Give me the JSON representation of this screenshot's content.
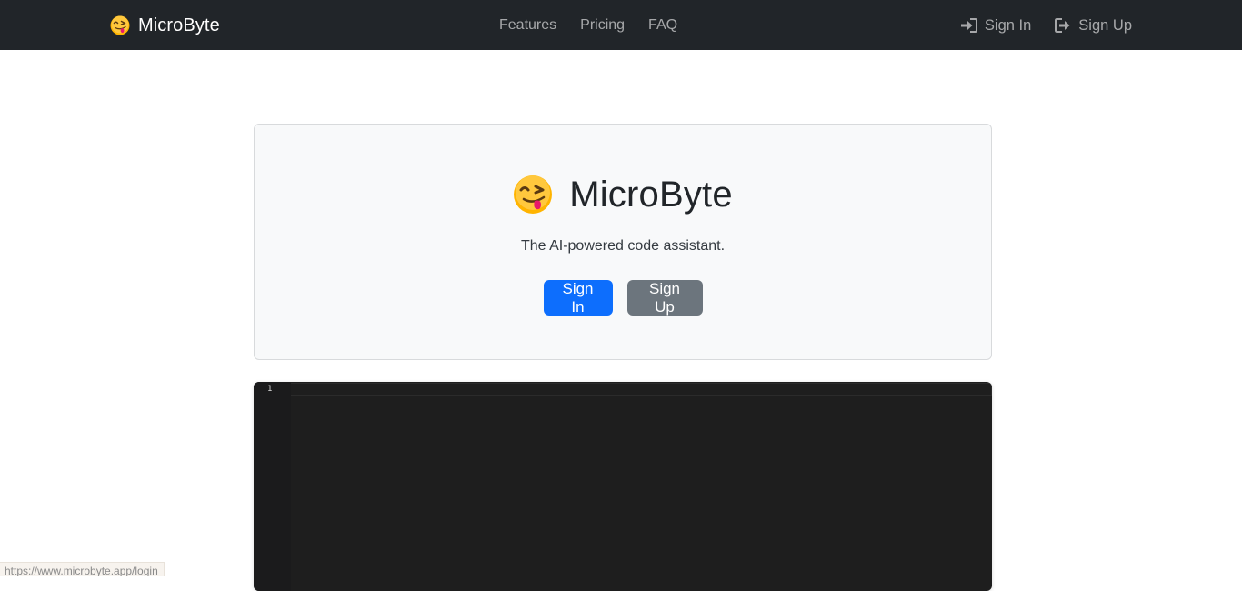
{
  "navbar": {
    "brand": {
      "icon": "face-savoring-food-emoji",
      "label": "MicroByte"
    },
    "links": [
      "Features",
      "Pricing",
      "FAQ"
    ],
    "sign_in": {
      "icon": "sign-in-icon",
      "label": "Sign In"
    },
    "sign_up": {
      "icon": "sign-out-icon",
      "label": "Sign Up"
    }
  },
  "hero": {
    "icon": "face-savoring-food-emoji",
    "title": "MicroByte",
    "tagline": "The AI-powered code assistant.",
    "sign_in_button": "Sign In",
    "sign_up_button": "Sign Up"
  },
  "editor": {
    "line_numbers": [
      "1"
    ],
    "content": ""
  },
  "status_bar": {
    "hover_url": "https://www.microbyte.app/login"
  },
  "colors": {
    "navbar_bg": "#212529",
    "primary": "#0d6efd",
    "secondary": "#6c757d",
    "hero_bg": "#f8f9fa",
    "editor_bg": "#1e1e1e",
    "emoji_yellow": "#ffb400",
    "emoji_tongue": "#e8196b"
  }
}
